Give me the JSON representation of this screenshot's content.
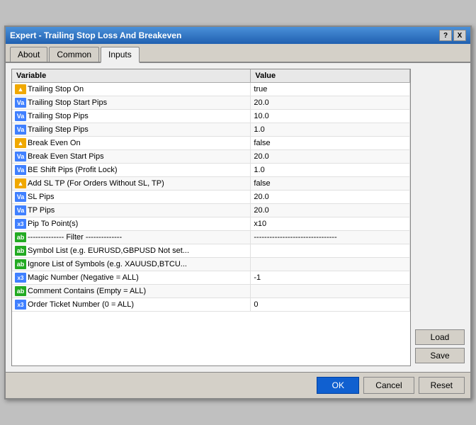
{
  "window": {
    "title": "Expert - Trailing Stop Loss And Breakeven",
    "help_btn": "?",
    "close_btn": "X"
  },
  "tabs": [
    {
      "label": "About",
      "active": false
    },
    {
      "label": "Common",
      "active": false
    },
    {
      "label": "Inputs",
      "active": true
    }
  ],
  "table": {
    "col_variable": "Variable",
    "col_value": "Value",
    "rows": [
      {
        "icon": "bool",
        "variable": "Trailing Stop On",
        "value": "true"
      },
      {
        "icon": "num",
        "variable": "Trailing Stop Start Pips",
        "value": "20.0"
      },
      {
        "icon": "num",
        "variable": "Trailing Stop Pips",
        "value": "10.0"
      },
      {
        "icon": "num",
        "variable": "Trailing Step Pips",
        "value": "1.0"
      },
      {
        "icon": "bool",
        "variable": "Break Even On",
        "value": "false"
      },
      {
        "icon": "num",
        "variable": "Break Even Start Pips",
        "value": "20.0"
      },
      {
        "icon": "num",
        "variable": "BE Shift Pips (Profit Lock)",
        "value": "1.0"
      },
      {
        "icon": "bool",
        "variable": "Add SL TP (For Orders Without SL, TP)",
        "value": "false"
      },
      {
        "icon": "num",
        "variable": "SL Pips",
        "value": "20.0"
      },
      {
        "icon": "num",
        "variable": "TP Pips",
        "value": "20.0"
      },
      {
        "icon": "pip",
        "variable": "Pip To Point(s)",
        "value": "x10"
      },
      {
        "icon": "str",
        "variable": "-------------- Filter --------------",
        "value": "--------------------------------"
      },
      {
        "icon": "str",
        "variable": "Symbol List (e.g. EURUSD,GBPUSD Not set...",
        "value": ""
      },
      {
        "icon": "str",
        "variable": "Ignore List of Symbols (e.g. XAUUSD,BTCU...",
        "value": ""
      },
      {
        "icon": "pip",
        "variable": "Magic Number (Negative = ALL)",
        "value": "-1"
      },
      {
        "icon": "str",
        "variable": "Comment Contains (Empty = ALL)",
        "value": ""
      },
      {
        "icon": "pip",
        "variable": "Order Ticket Number (0 = ALL)",
        "value": "0"
      }
    ]
  },
  "buttons": {
    "load": "Load",
    "save": "Save",
    "ok": "OK",
    "cancel": "Cancel",
    "reset": "Reset"
  },
  "icons": {
    "bool": "▲",
    "num": "Va",
    "str": "ab",
    "pip": "x3"
  }
}
